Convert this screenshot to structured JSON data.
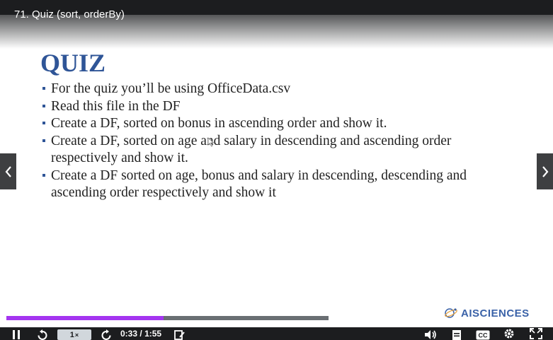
{
  "video": {
    "title": "71. Quiz (sort, orderBy)"
  },
  "slide": {
    "heading": "QUIZ",
    "bullets": [
      "For the quiz you’ll be using OfficeData.csv",
      "Read this file in the DF",
      "Create a DF, sorted on bonus in ascending order and show it.",
      "Create a DF, sorted on age and salary in descending and ascending order respectively and show it.",
      "Create a DF sorted on age, bonus and salary in descending, descending and ascending order respectively and show it"
    ],
    "logo_text": "AISCIENCES",
    "heading_color": "#2f5597"
  },
  "player": {
    "progress_fraction": 0.487,
    "played_color": "#a435f0",
    "speed_value": "1",
    "speed_suffix": "×",
    "current_time": "0:33",
    "time_separator": "/",
    "duration": "1:55",
    "icons": {
      "play_pause": "pause-icon",
      "rewind": "rewind-icon",
      "forward": "forward-icon",
      "notes": "add-note-icon",
      "volume": "volume-icon",
      "transcript": "transcript-icon",
      "captions": "closed-captions-icon",
      "settings": "settings-icon",
      "fullscreen": "fullscreen-icon"
    },
    "captions_label": "CC"
  }
}
